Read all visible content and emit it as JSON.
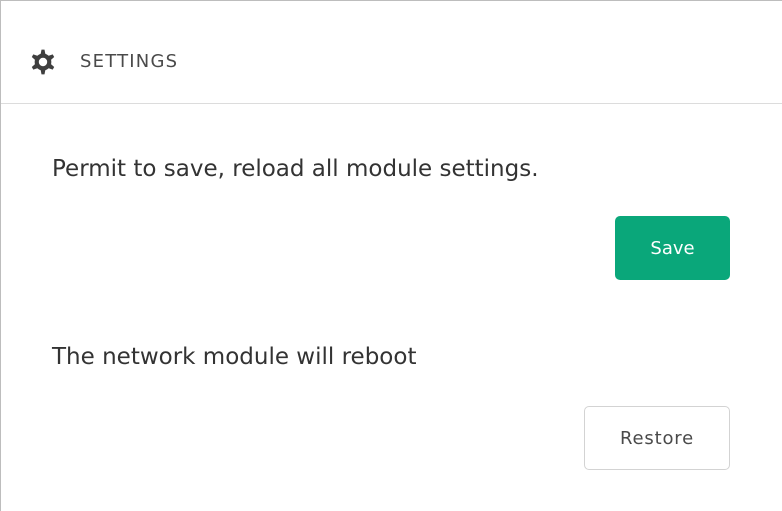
{
  "header": {
    "title": "SETTINGS",
    "icon": "gear-icon"
  },
  "save_section": {
    "description": "Permit to save, reload all module settings.",
    "button_label": "Save",
    "button_color": "#0aa77a"
  },
  "restore_section": {
    "description": "The network module will reboot",
    "button_label": "Restore"
  }
}
